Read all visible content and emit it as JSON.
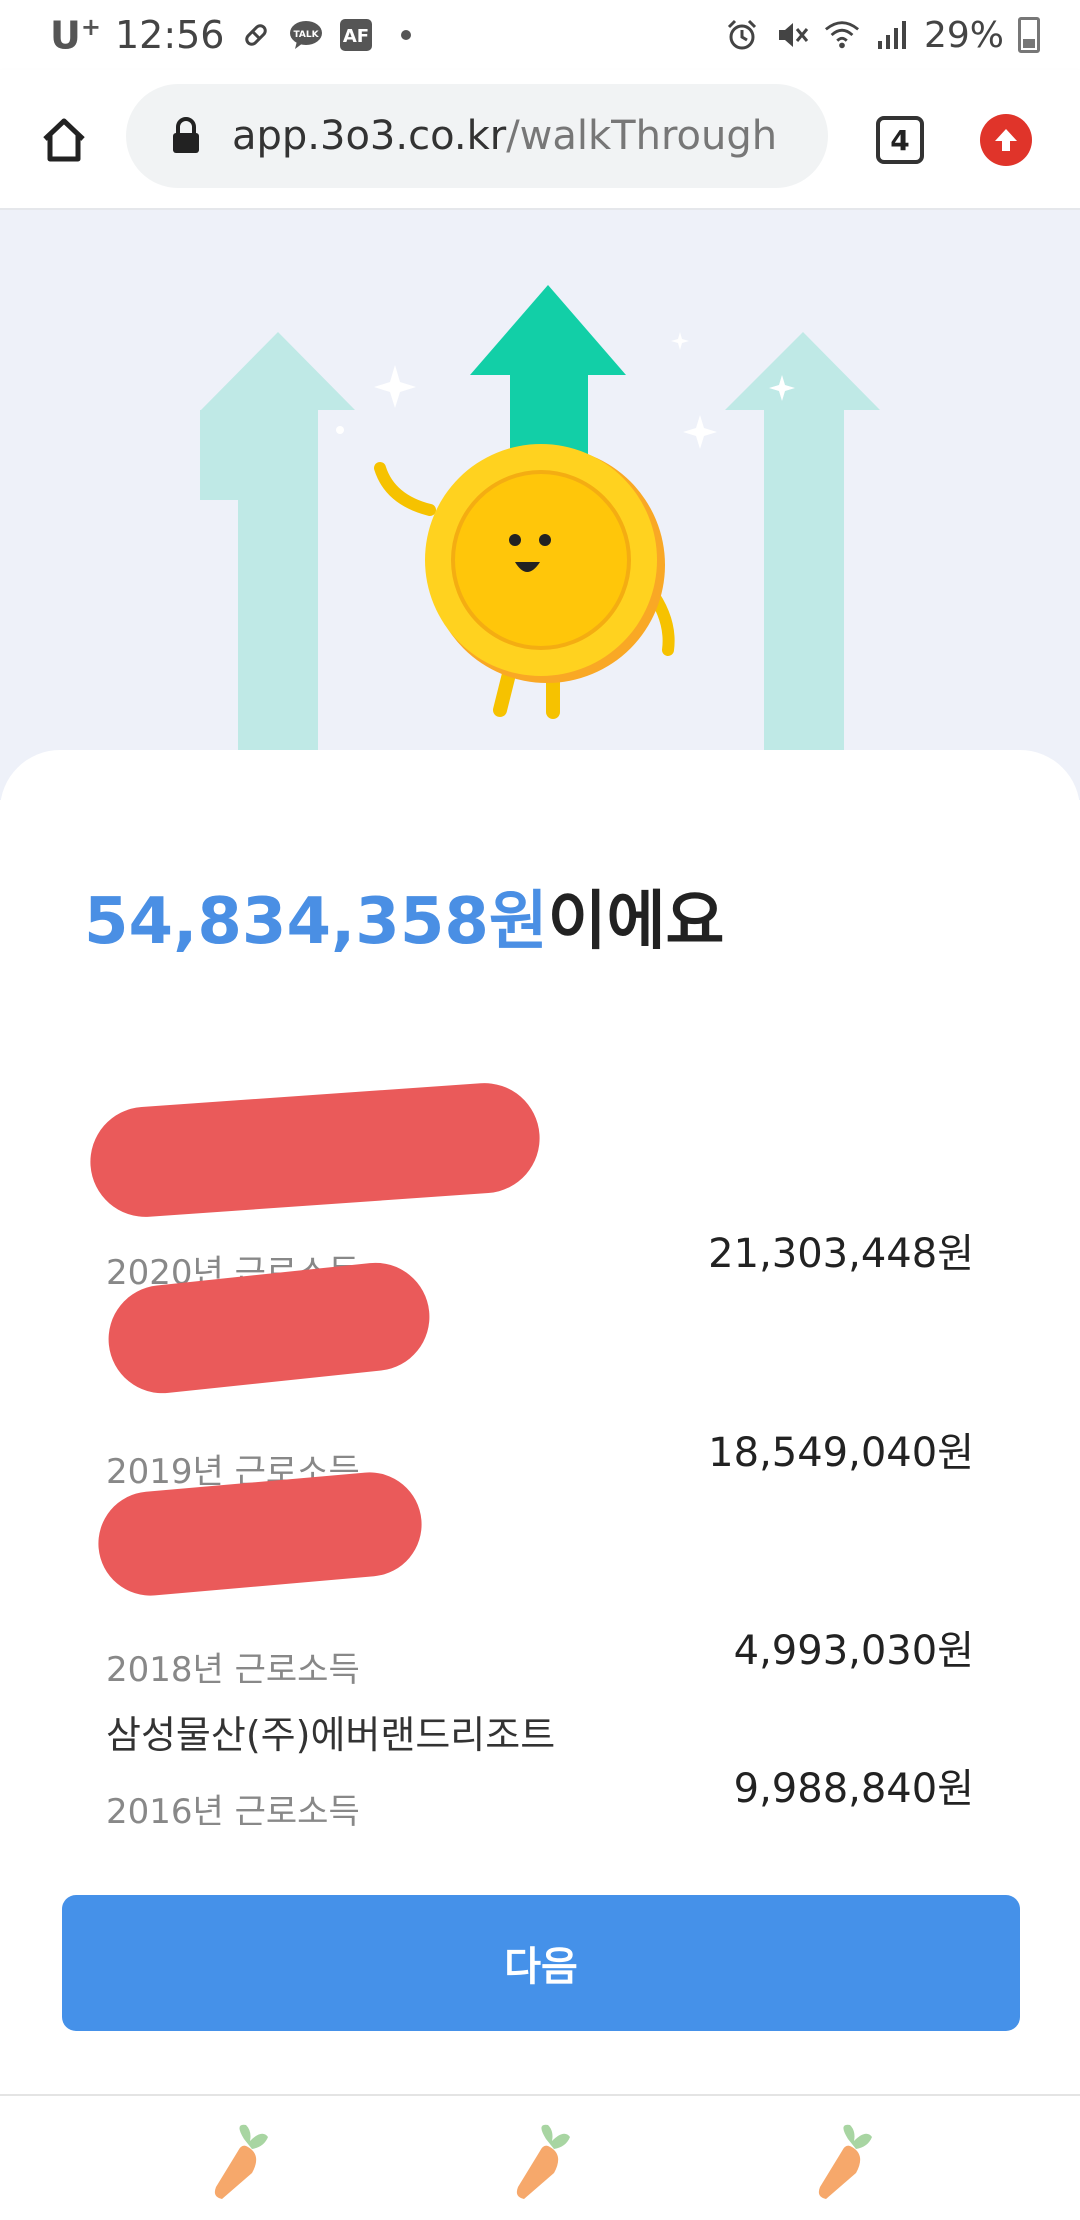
{
  "status_bar": {
    "carrier": "U",
    "carrier_sup": "+",
    "time": "12:56",
    "battery": "29%",
    "icons": [
      "pill-icon",
      "talk-icon",
      "af-icon",
      "dot-icon",
      "alarm-icon",
      "mute-icon",
      "wifi-icon",
      "signal-icon",
      "battery-icon"
    ]
  },
  "browser": {
    "url_domain": "app.3o3.co.kr",
    "url_path": "/walkThrough",
    "tab_count": "4"
  },
  "summary": {
    "amount": "54,834,358원",
    "suffix": "이에요",
    "accent_color": "#4a8fe4"
  },
  "incomes": [
    {
      "company": "",
      "year_label": "2020년 근로소득",
      "amount": "21,303,448원",
      "redacted": true
    },
    {
      "company": "",
      "year_label": "2019년 근로소득",
      "amount": "18,549,040원",
      "redacted": true
    },
    {
      "company": "",
      "year_label": "2018년 근로소득",
      "amount": "4,993,030원",
      "redacted": true
    },
    {
      "company": "삼성물산(주)에버랜드리조트",
      "year_label": "2016년 근로소득",
      "amount": "9,988,840원",
      "redacted": false
    }
  ],
  "next_button": {
    "label": "다음",
    "color": "#4591e9"
  },
  "bottom_nav": {
    "icons": [
      "carrot-icon",
      "carrot-icon",
      "carrot-icon"
    ]
  }
}
